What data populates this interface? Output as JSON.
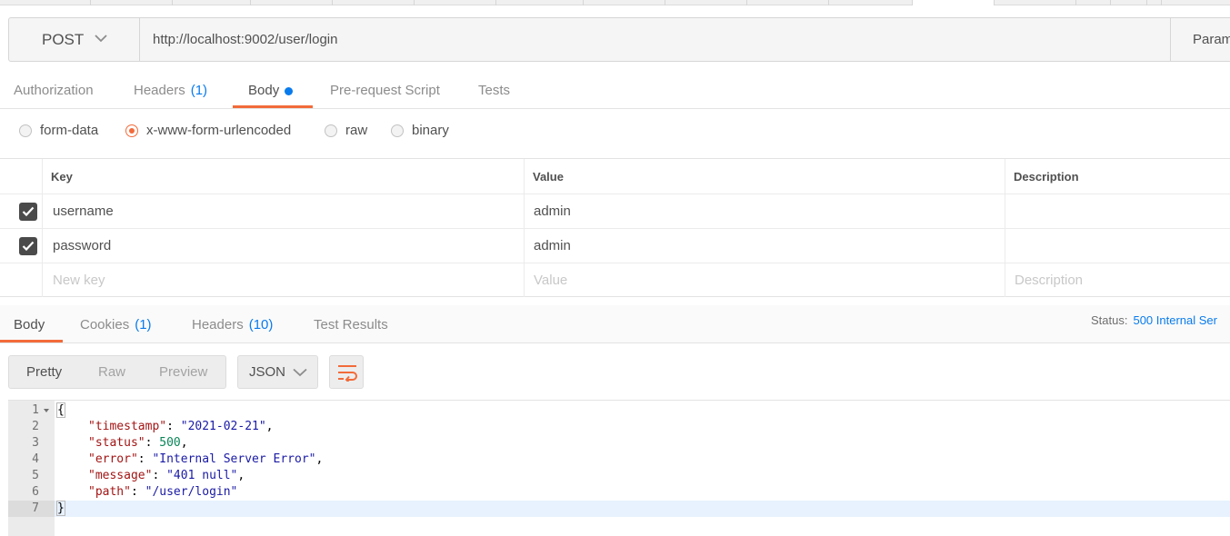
{
  "request": {
    "method": "POST",
    "url": "http://localhost:9002/user/login",
    "params_label": "Param"
  },
  "request_tabs": [
    {
      "label": "Authorization",
      "count": ""
    },
    {
      "label": "Headers",
      "count": "(1)"
    },
    {
      "label": "Body",
      "count": ""
    },
    {
      "label": "Pre-request Script",
      "count": ""
    },
    {
      "label": "Tests",
      "count": ""
    }
  ],
  "body_types": [
    {
      "label": "form-data",
      "selected": false
    },
    {
      "label": "x-www-form-urlencoded",
      "selected": true
    },
    {
      "label": "raw",
      "selected": false
    },
    {
      "label": "binary",
      "selected": false
    }
  ],
  "params_table": {
    "headers": [
      "Key",
      "Value",
      "Description"
    ],
    "rows": [
      {
        "key": "username",
        "value": "admin",
        "description": "",
        "checked": true
      },
      {
        "key": "password",
        "value": "admin",
        "description": "",
        "checked": true
      }
    ],
    "new_row": {
      "key": "New key",
      "value": "Value",
      "description": "Description"
    }
  },
  "response_tabs": [
    {
      "label": "Body",
      "count": ""
    },
    {
      "label": "Cookies",
      "count": "(1)"
    },
    {
      "label": "Headers",
      "count": "(10)"
    },
    {
      "label": "Test Results",
      "count": ""
    }
  ],
  "status": {
    "label": "Status:",
    "value": "500 Internal Ser"
  },
  "response_view": {
    "formats": [
      "Pretty",
      "Raw",
      "Preview"
    ],
    "active_format": "Pretty",
    "language": "JSON"
  },
  "response_body": {
    "line_numbers": [
      "1",
      "2",
      "3",
      "4",
      "5",
      "6",
      "7"
    ],
    "open_brace": "{",
    "close_brace": "}",
    "fields": [
      {
        "key": "\"timestamp\"",
        "value": "\"2021-02-21\"",
        "type": "string",
        "trail": ","
      },
      {
        "key": "\"status\"",
        "value": "500",
        "type": "number",
        "trail": ","
      },
      {
        "key": "\"error\"",
        "value": "\"Internal Server Error\"",
        "type": "string",
        "trail": ","
      },
      {
        "key": "\"message\"",
        "value": "\"401 null\"",
        "type": "string",
        "trail": ","
      },
      {
        "key": "\"path\"",
        "value": "\"/user/login\"",
        "type": "string",
        "trail": ""
      }
    ]
  },
  "colors": {
    "accent": "#f26b3a",
    "link": "#097bed",
    "json_key": "#a31515",
    "json_string": "#1a1aa6",
    "json_number": "#098658"
  }
}
